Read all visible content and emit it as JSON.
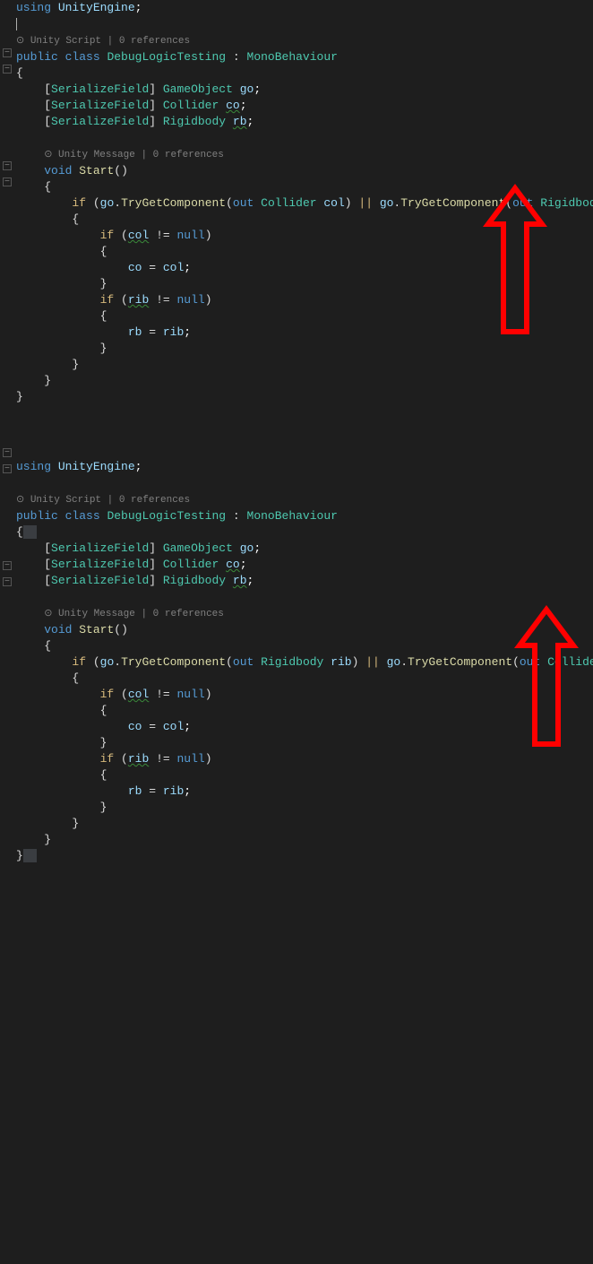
{
  "block1": {
    "using": "using",
    "namespace": "UnityEngine",
    "refs1": "⊙ Unity Script | 0 references",
    "public": "public",
    "class": "class",
    "className": "DebugLogicTesting",
    "colon": ":",
    "base": "MonoBehaviour",
    "sf_open": "[",
    "sf": "SerializeField",
    "sf_close": "]",
    "type_go": "GameObject",
    "field_go": "go",
    "type_col": "Collider",
    "field_co": "co",
    "type_rb": "Rigidbody",
    "field_rb": "rb",
    "refs2": "⊙ Unity Message | 0 references",
    "void": "void",
    "start": "Start",
    "if": "if",
    "out": "out",
    "tryGet": "TryGetComponent",
    "var_col": "col",
    "var_rib": "rib",
    "null": "null",
    "assign1_l": "co",
    "assign1_r": "col",
    "assign2_l": "rb",
    "assign2_r": "rib"
  },
  "block2": {
    "using": "using",
    "namespace": "UnityEngine",
    "refs1": "⊙ Unity Script | 0 references",
    "public": "public",
    "class": "class",
    "className": "DebugLogicTesting",
    "colon": ":",
    "base": "MonoBehaviour",
    "sf_open": "[",
    "sf": "SerializeField",
    "sf_close": "]",
    "type_go": "GameObject",
    "field_go": "go",
    "type_col": "Collider",
    "field_co": "co",
    "type_rb": "Rigidbody",
    "field_rb": "rb",
    "refs2": "⊙ Unity Message | 0 references",
    "void": "void",
    "start": "Start",
    "if": "if",
    "out": "out",
    "tryGet": "TryGetComponent",
    "var_col": "col",
    "var_rib": "rib",
    "null": "null",
    "assign1_l": "co",
    "assign1_r": "col",
    "assign2_l": "rb",
    "assign2_r": "rib"
  },
  "arrow_color": "#ff0000"
}
